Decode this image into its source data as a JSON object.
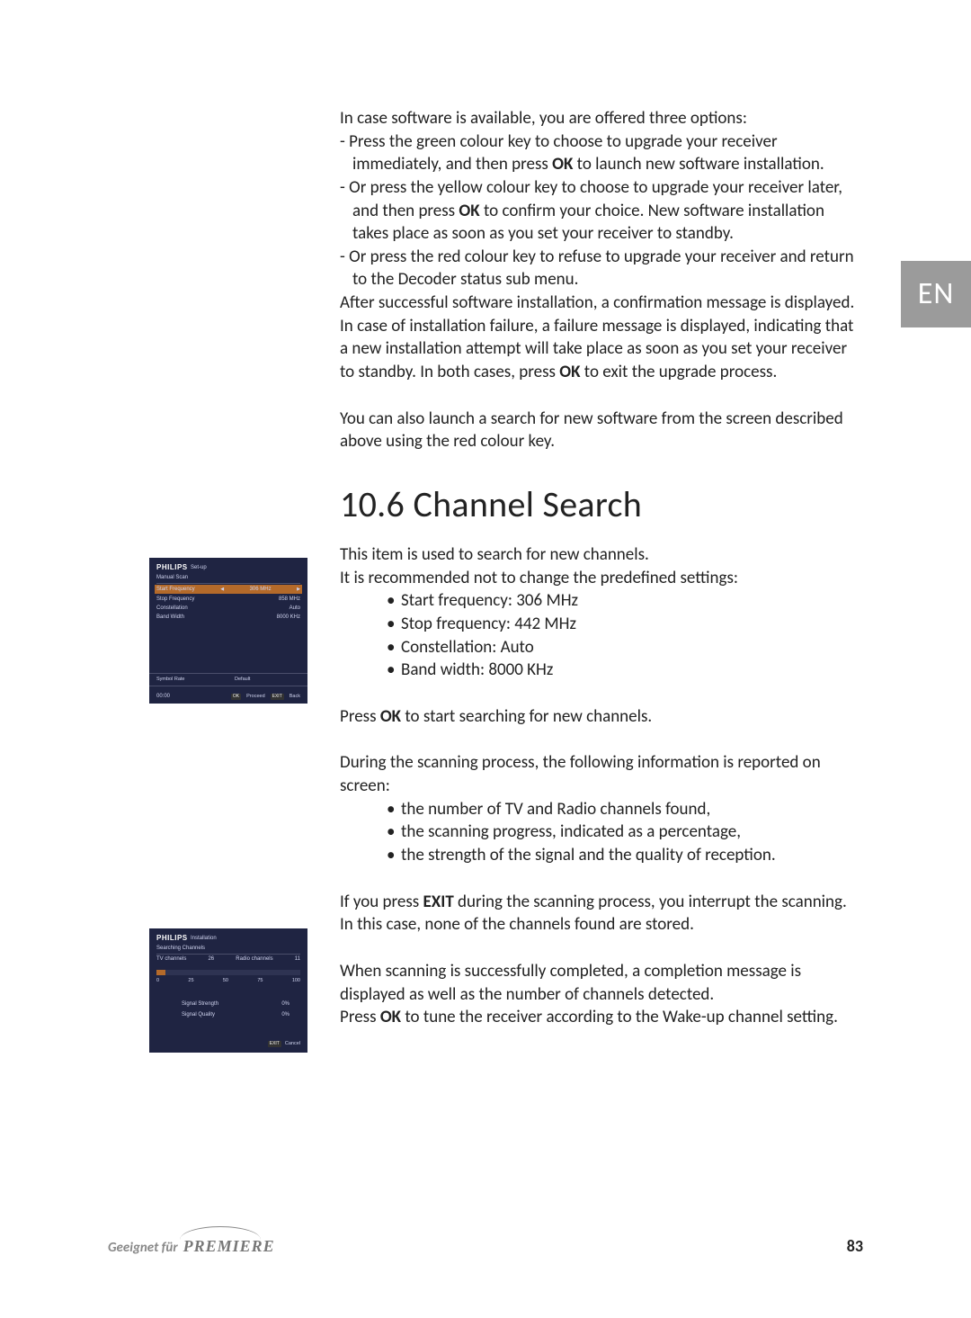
{
  "lang_tab": "EN",
  "p_intro": "In case software is available, you are offered three options:",
  "li1a": "- Press the green colour key to choose to upgrade your receiver immediately, and then press ",
  "li1b": " to launch new software installation.",
  "li2a": "- Or press the yellow colour key to choose to upgrade your receiver later, and then press ",
  "li2b": " to confirm your choice. New software installation takes place as soon as you set your receiver to standby.",
  "li3": "- Or press the red colour key to refuse to upgrade your receiver and return to the Decoder status sub menu.",
  "p_after_a": "After successful software installation, a confirmation message is displayed. In case of installation failure, a failure message is displayed, indicating that a new installation attempt will take place as soon as you set your receiver to standby. In both cases, press ",
  "p_after_b": " to exit the upgrade process.",
  "p_also": "You can also launch a search for new software from the screen described above using the red colour key.",
  "section_title": "10.6 Channel Search",
  "cs_intro1": "This item is used to search for new channels.",
  "cs_intro2": "It is recommended not to change the predefined settings:",
  "settings": {
    "start": "Start frequency: 306 MHz",
    "stop": "Stop frequency: 442 MHz",
    "const": "Constellation: Auto",
    "bw": "Band width: 8000 KHz"
  },
  "press_ok_search_a": "Press ",
  "press_ok_search_b": " to start searching for new channels.",
  "scan_intro": "During the scanning process, the following information is reported on screen:",
  "scaninfo": {
    "a": "the number of TV and Radio channels found,",
    "b": "the scanning progress, indicated as a percentage,",
    "c": "the strength of the signal and the quality of reception."
  },
  "exit_a": "If you press ",
  "exit_b": " during the scanning process, you interrupt the scanning. In this case, none of the channels found are stored.",
  "complete": "When scanning is successfully completed, a completion message is displayed as well as the number of channels detected.",
  "tune_a": "Press ",
  "tune_b": " to tune the receiver according to the Wake-up channel setting.",
  "bold": {
    "ok": "OK",
    "exit": "EXIT"
  },
  "screenshot1": {
    "brand": "PHILIPS",
    "mode": "Set-up",
    "title": "Manual Scan",
    "rows": [
      {
        "label": "Start Frequency",
        "value": "306 MHz",
        "selected": true
      },
      {
        "label": "Stop Frequency",
        "value": "858 MHz"
      },
      {
        "label": "Constellation",
        "value": "Auto"
      },
      {
        "label": "Band Width",
        "value": "8000 KHz"
      }
    ],
    "hint_left": "Symbol Rate",
    "hint_mid": "Default",
    "foot_time": "00:00",
    "foot_proceed": "Proceed",
    "foot_back": "Back",
    "foot_back_key": "EXIT",
    "foot_proceed_key": "OK"
  },
  "screenshot2": {
    "brand": "PHILIPS",
    "mode": "Installation",
    "title": "Searching Channels",
    "tv_label": "TV channels",
    "tv_count": "26",
    "radio_label": "Radio channels",
    "radio_count": "11",
    "ticks": [
      "0",
      "25",
      "50",
      "75",
      "100"
    ],
    "sig_strength_label": "Signal Strength",
    "sig_strength_val": "0%",
    "sig_quality_label": "Signal Quality",
    "sig_quality_val": "0%",
    "foot_cancel": "Cancel",
    "foot_cancel_key": "EXIT"
  },
  "footer": {
    "fit": "Geeignet für",
    "premiere": "PREMIERE",
    "page": "83"
  }
}
